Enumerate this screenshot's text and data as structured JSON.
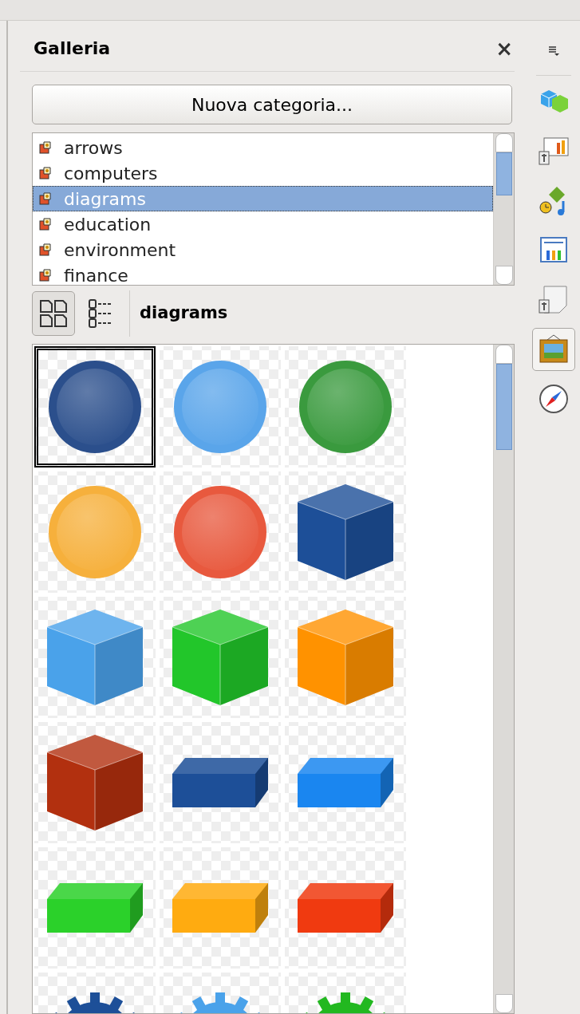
{
  "panel": {
    "title": "Galleria",
    "close": "×"
  },
  "new_category_button": "Nuova categoria...",
  "categories": [
    {
      "label": "arrows",
      "selected": false
    },
    {
      "label": "computers",
      "selected": false
    },
    {
      "label": "diagrams",
      "selected": true
    },
    {
      "label": "education",
      "selected": false
    },
    {
      "label": "environment",
      "selected": false
    },
    {
      "label": "finance",
      "selected": false
    }
  ],
  "view_modes": [
    {
      "kind": "icons",
      "selected": true
    },
    {
      "kind": "details",
      "selected": false
    }
  ],
  "current_category": "diagrams",
  "gallery_items": [
    {
      "kind": "sphere",
      "color": "#2b4f8c",
      "selected": true
    },
    {
      "kind": "sphere",
      "color": "#5aa5ea",
      "selected": false
    },
    {
      "kind": "sphere",
      "color": "#3a9a3e",
      "selected": false
    },
    {
      "kind": "sphere",
      "color": "#f6b03c",
      "selected": false
    },
    {
      "kind": "sphere",
      "color": "#e8593e",
      "selected": false
    },
    {
      "kind": "cube",
      "color": "#1d4f98",
      "selected": false
    },
    {
      "kind": "cube",
      "color": "#4aa2ea",
      "selected": false
    },
    {
      "kind": "cube",
      "color": "#22c62a",
      "selected": false
    },
    {
      "kind": "cube",
      "color": "#ff9200",
      "selected": false
    },
    {
      "kind": "cube",
      "color": "#b2300f",
      "selected": false
    },
    {
      "kind": "box",
      "color": "#1d4f98",
      "selected": false
    },
    {
      "kind": "box",
      "color": "#1a86f0",
      "selected": false
    },
    {
      "kind": "box",
      "color": "#2bd12a",
      "selected": false
    },
    {
      "kind": "box",
      "color": "#ffab10",
      "selected": false
    },
    {
      "kind": "box",
      "color": "#f03a10",
      "selected": false
    },
    {
      "kind": "gear",
      "color": "#1d4f98",
      "selected": false
    },
    {
      "kind": "gear",
      "color": "#4aa2ea",
      "selected": false
    },
    {
      "kind": "gear",
      "color": "#22b820",
      "selected": false
    }
  ],
  "deck_tabs": [
    {
      "kind": "properties",
      "selected": false
    },
    {
      "kind": "slide-transition",
      "selected": false
    },
    {
      "kind": "animation",
      "selected": false
    },
    {
      "kind": "master-slides",
      "selected": false
    },
    {
      "kind": "styles",
      "selected": false
    },
    {
      "kind": "gallery",
      "selected": true
    },
    {
      "kind": "navigator",
      "selected": false
    }
  ]
}
